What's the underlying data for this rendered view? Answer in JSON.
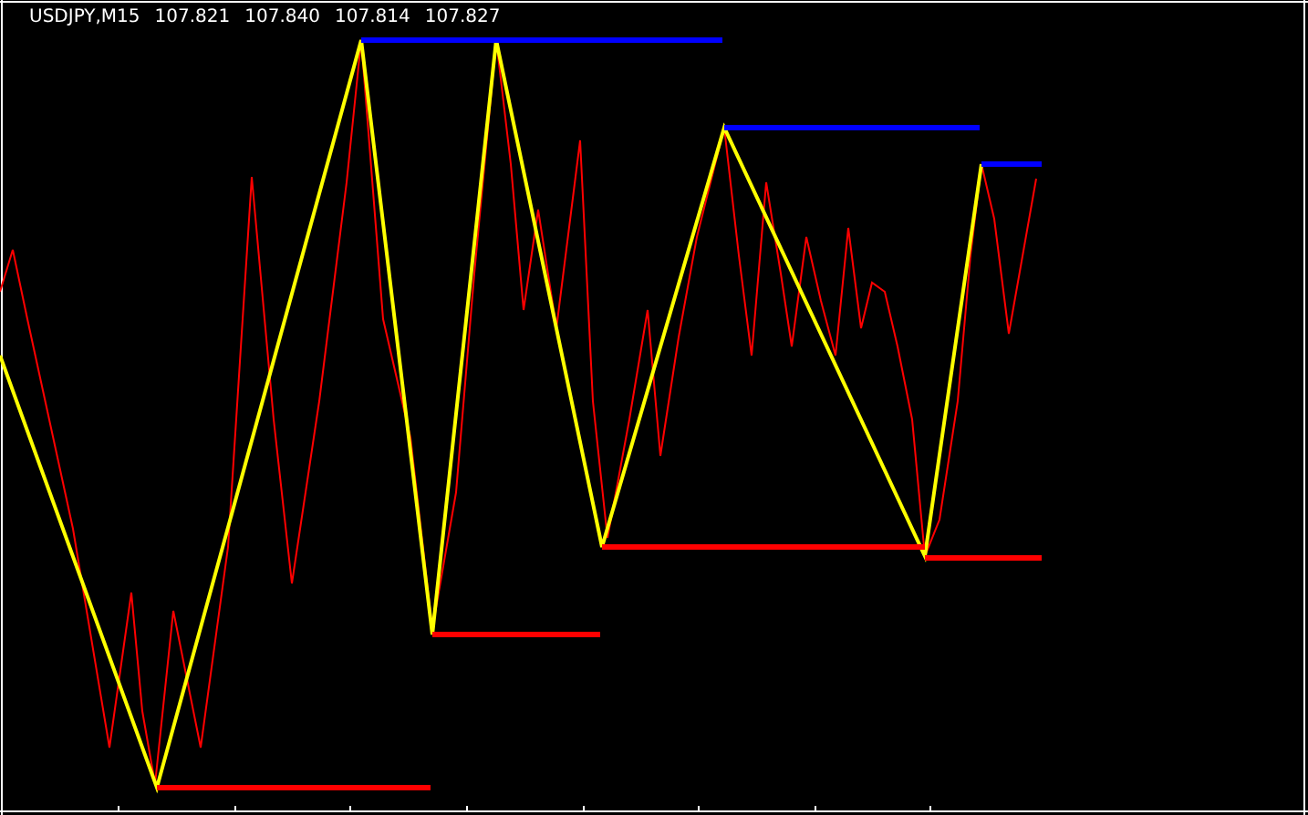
{
  "chart": {
    "symbol": "USDJPY,M15",
    "prices": [
      "107.821",
      "107.840",
      "107.814",
      "107.827"
    ]
  }
}
